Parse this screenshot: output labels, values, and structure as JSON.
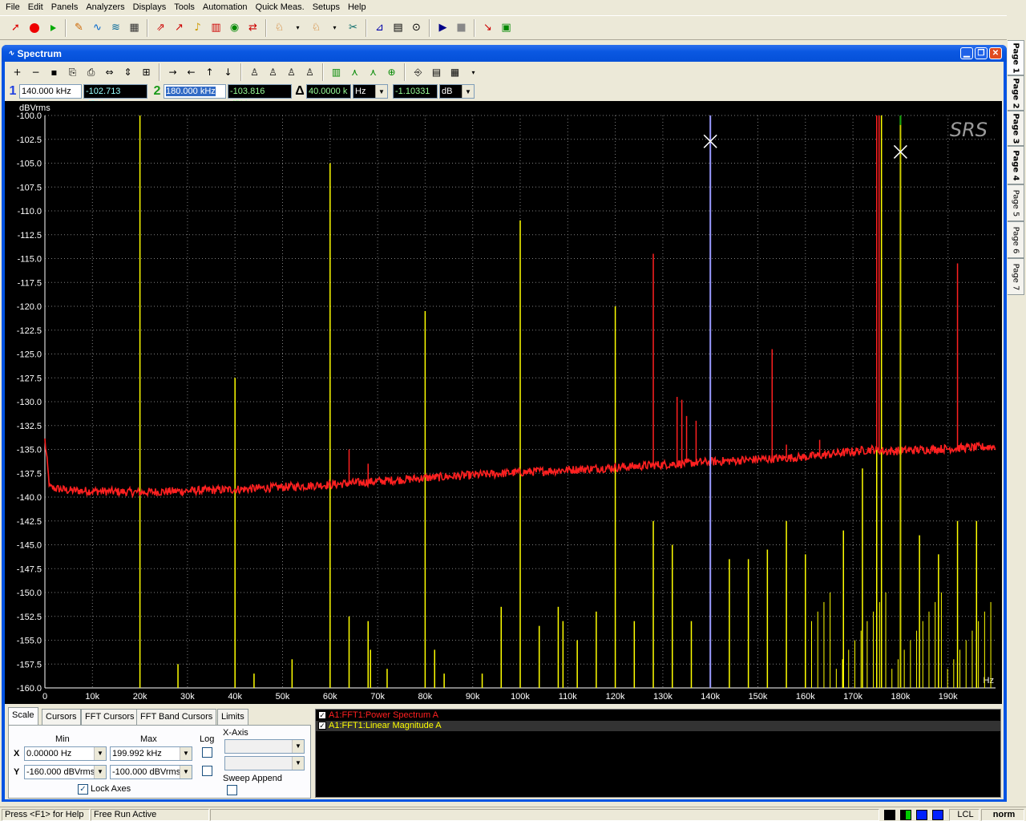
{
  "menu": [
    "File",
    "Edit",
    "Panels",
    "Analyzers",
    "Displays",
    "Tools",
    "Automation",
    "Quick Meas.",
    "Setups",
    "Help"
  ],
  "page_tabs": [
    "Page 1",
    "Page 2",
    "Page 3",
    "Page 4",
    "Page 5",
    "Page 6",
    "Page 7"
  ],
  "window": {
    "title": "Spectrum"
  },
  "cursors": {
    "c1_num": "1",
    "c1_x": "140.000 kHz",
    "c1_y": "-102.713 dBVrm",
    "c2_num": "2",
    "c2_x": "180.000 kHz",
    "c2_y": "-103.816 dBVrm",
    "delta_sym": "Δ",
    "dx": "40.0000 k",
    "dx_unit": "Hz",
    "dy": "-1.10331",
    "dy_unit": "dB"
  },
  "chart_data": {
    "type": "line",
    "ylabel": "dBVrms",
    "xlabel": "Hz",
    "xlim": [
      0,
      200000
    ],
    "ylim": [
      -160,
      -100
    ],
    "x_ticks": [
      "0",
      "10k",
      "20k",
      "30k",
      "40k",
      "50k",
      "60k",
      "70k",
      "80k",
      "90k",
      "100k",
      "110k",
      "120k",
      "130k",
      "140k",
      "150k",
      "160k",
      "170k",
      "180k",
      "190k"
    ],
    "y_ticks": [
      "-100.0",
      "-102.5",
      "-105.0",
      "-107.5",
      "-110.0",
      "-112.5",
      "-115.0",
      "-117.5",
      "-120.0",
      "-122.5",
      "-125.0",
      "-127.5",
      "-130.0",
      "-132.5",
      "-135.0",
      "-137.5",
      "-140.0",
      "-142.5",
      "-145.0",
      "-147.5",
      "-150.0",
      "-152.5",
      "-155.0",
      "-157.5",
      "-160.0"
    ],
    "grid": true,
    "watermark": "SRS",
    "series": [
      {
        "name": "A1:FFT1:Power Spectrum A",
        "color": "#ff2020",
        "noise_floor": [
          [
            0,
            -134
          ],
          [
            1000,
            -139
          ],
          [
            5000,
            -139.3
          ],
          [
            20000,
            -139.5
          ],
          [
            40000,
            -139.2
          ],
          [
            60000,
            -138.7
          ],
          [
            80000,
            -138.0
          ],
          [
            100000,
            -137.4
          ],
          [
            120000,
            -136.9
          ],
          [
            140000,
            -136.3
          ],
          [
            160000,
            -135.8
          ],
          [
            174000,
            -135.0
          ],
          [
            177000,
            -135.2
          ],
          [
            200000,
            -134.7
          ]
        ],
        "spurs": [
          [
            64000,
            -135
          ],
          [
            68000,
            -136.5
          ],
          [
            128000,
            -114.5
          ],
          [
            133000,
            -129.5
          ],
          [
            134000,
            -129.8
          ],
          [
            135000,
            -131.5
          ],
          [
            137000,
            -132
          ],
          [
            153000,
            -124.5
          ],
          [
            156000,
            -134.5
          ],
          [
            163000,
            -134
          ],
          [
            175000,
            -100
          ],
          [
            175500,
            -100
          ],
          [
            192000,
            -115.5
          ]
        ]
      },
      {
        "name": "A1:FFT1:Linear Magnitude A",
        "color": "#ffff00",
        "lines": [
          [
            20000,
            -100
          ],
          [
            28000,
            -157.5
          ],
          [
            40000,
            -127.5
          ],
          [
            44000,
            -158.5
          ],
          [
            52000,
            -157
          ],
          [
            60000,
            -105
          ],
          [
            64000,
            -152.5
          ],
          [
            68000,
            -153
          ],
          [
            68500,
            -156
          ],
          [
            72000,
            -158
          ],
          [
            80000,
            -120.5
          ],
          [
            82000,
            -156
          ],
          [
            84000,
            -158.5
          ],
          [
            92000,
            -158.5
          ],
          [
            96000,
            -151.5
          ],
          [
            100000,
            -111
          ],
          [
            104000,
            -153.5
          ],
          [
            108000,
            -151.5
          ],
          [
            109000,
            -153
          ],
          [
            112000,
            -155
          ],
          [
            116000,
            -152
          ],
          [
            120000,
            -120
          ],
          [
            124000,
            -153
          ],
          [
            128000,
            -142.5
          ],
          [
            132000,
            -145
          ],
          [
            136000,
            -153
          ],
          [
            140000,
            -137
          ],
          [
            144000,
            -146.5
          ],
          [
            148000,
            -146.5
          ],
          [
            152000,
            -145.5
          ],
          [
            156000,
            -142.5
          ],
          [
            160000,
            -146
          ],
          [
            168000,
            -143.5
          ],
          [
            172000,
            -137
          ],
          [
            175000,
            -100
          ],
          [
            176000,
            -100
          ],
          [
            180000,
            -140
          ],
          [
            184000,
            -144
          ],
          [
            188000,
            -146
          ],
          [
            192000,
            -142.5
          ],
          [
            196000,
            -142.5
          ]
        ]
      }
    ],
    "cursors": [
      {
        "x": 140000,
        "y": -102.713,
        "color": "#9a9aff"
      },
      {
        "x": 180000,
        "y": -103.816,
        "color": "#cccc00"
      }
    ]
  },
  "bottom_tabs": [
    "Scale",
    "Cursors",
    "FFT Cursors",
    "FFT Band Cursors",
    "Limits"
  ],
  "scale": {
    "min_label": "Min",
    "max_label": "Max",
    "log_label": "Log",
    "xaxis_label": "X-Axis",
    "x_label": "X",
    "y_label": "Y",
    "x_min": "0.00000 Hz",
    "x_max": "199.992 kHz",
    "y_min": "-160.000 dBVrms",
    "y_max": "-100.000 dBVrms",
    "lock_axes": "Lock Axes",
    "sweep_append": "Sweep Append"
  },
  "legend": [
    "A1:FFT1:Power Spectrum A",
    "A1:FFT1:Linear Magnitude A"
  ],
  "status": {
    "help": "Press <F1> for Help",
    "mode": "Free Run Active",
    "lcl": "LCL",
    "norm": "norm"
  }
}
